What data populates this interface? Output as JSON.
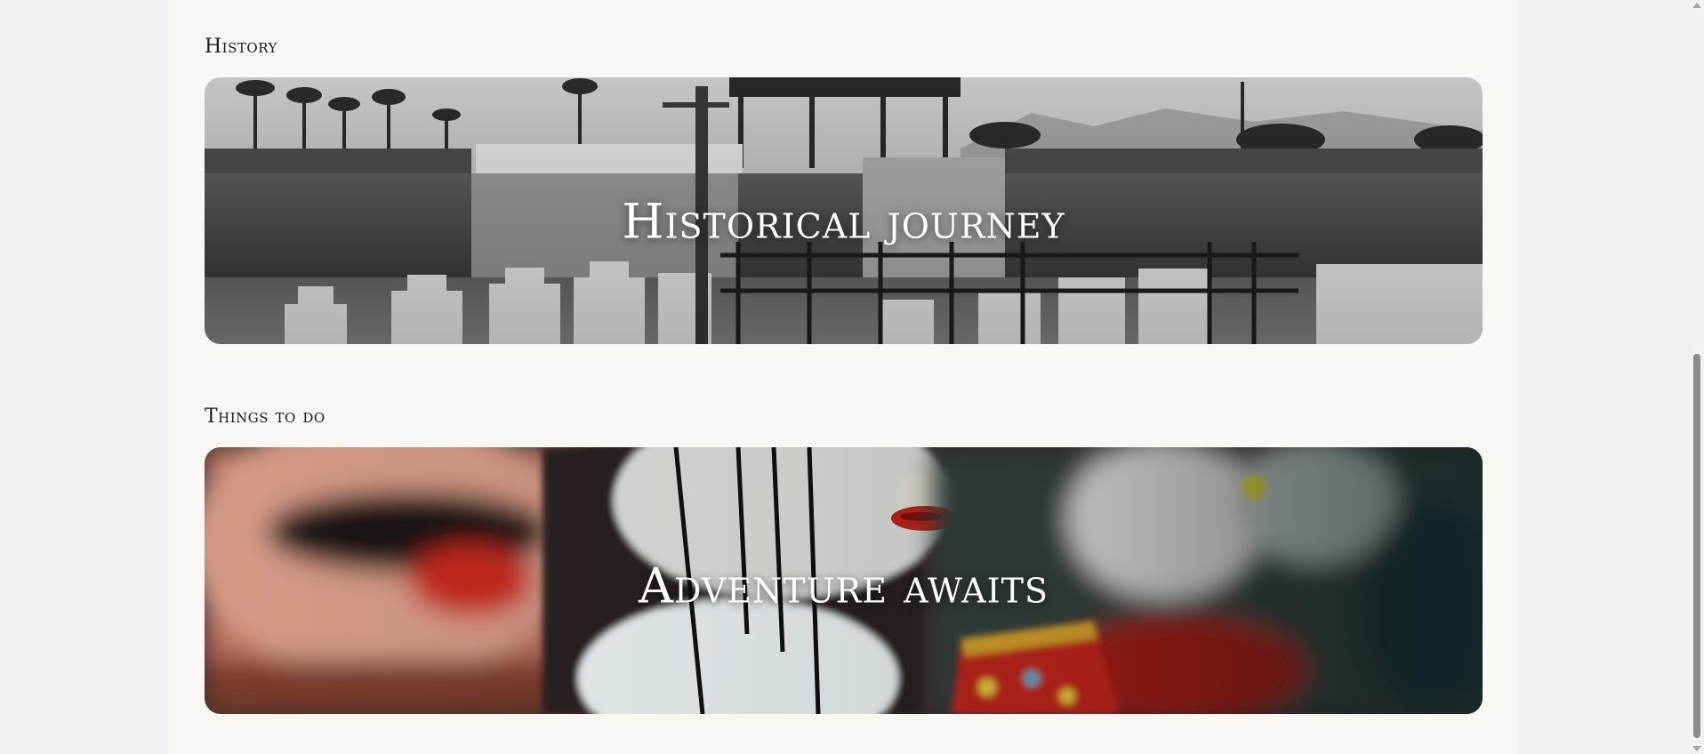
{
  "sections": [
    {
      "heading": "History",
      "banner_title": "Historical journey",
      "image": "black-and-white-palace-wall-photo"
    },
    {
      "heading": "Things to do",
      "banner_title": "Adventure awaits",
      "image": "marionette-puppets-photo"
    }
  ],
  "colors": {
    "page_background": "#f9f7f4",
    "outer_background": "#f0f0f0",
    "heading_text": "#1a1a1a",
    "banner_text": "#ffffff"
  }
}
